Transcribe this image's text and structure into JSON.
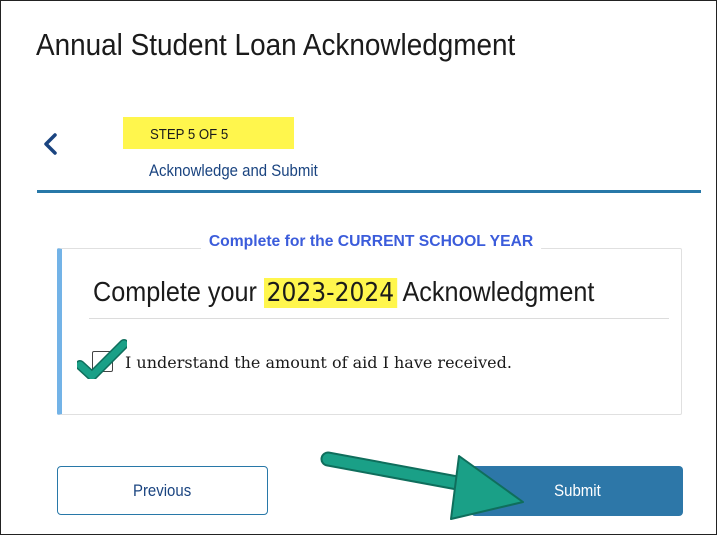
{
  "page": {
    "title": "Annual Student Loan Acknowledgment"
  },
  "stepper": {
    "back_icon": "chevron-left-icon",
    "step_label": "STEP 5 OF 5",
    "step_title": "Acknowledge and Submit"
  },
  "card": {
    "note": "Complete for the CURRENT SCHOOL YEAR",
    "heading_prefix": "Complete your ",
    "heading_year": "2023-2024",
    "heading_suffix": " Acknowledgment",
    "checkbox_label": "I understand the amount of aid I have received.",
    "checkbox_checked": true
  },
  "actions": {
    "previous_label": "Previous",
    "submit_label": "Submit"
  },
  "colors": {
    "accent": "#2878a8",
    "highlight": "#fff64d",
    "annotation_green": "#1aa087",
    "note_blue": "#3b5cdb"
  }
}
